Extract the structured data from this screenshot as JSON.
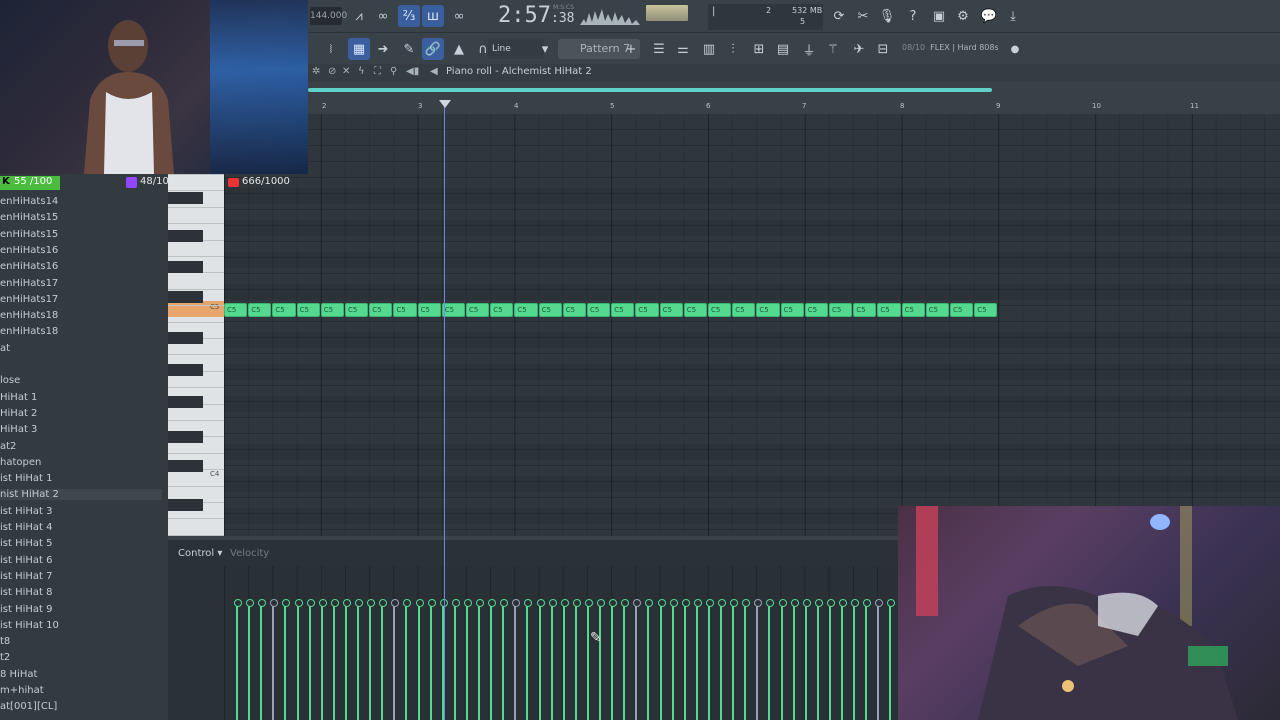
{
  "toolbar": {
    "tempo": "144.000",
    "time": {
      "minutes": "2:57",
      "seconds": "38",
      "unit_label": "M:S:CS"
    },
    "cpu": {
      "voices": "2",
      "memory": "532 MB",
      "polyphony": "5"
    },
    "draw_tool": "Line",
    "pattern": "Pattern 7",
    "hint": {
      "counter": "08/10",
      "text": "FLEX | Hard 808s"
    }
  },
  "piano_roll": {
    "title": "Piano roll - Alchemist HiHat 2",
    "bars": [
      "2",
      "3",
      "4",
      "5",
      "6",
      "7",
      "8",
      "9",
      "10",
      "11"
    ],
    "key_labels": {
      "c5": "C5",
      "c4": "C4"
    },
    "note_label": "C5"
  },
  "control": {
    "label": "Control",
    "target": "Velocity"
  },
  "counters": {
    "kick": {
      "icon": "K",
      "value": "55",
      "total": "/100"
    },
    "purple": "48/100",
    "youtube": "666/1000"
  },
  "browser": {
    "items": [
      "enHiHats14",
      "enHiHats15",
      "enHiHats15",
      "enHiHats16",
      "enHiHats16",
      "enHiHats17",
      "enHiHats17",
      "enHiHats18",
      "enHiHats18",
      "at",
      "",
      "lose",
      " HiHat 1",
      " HiHat 2",
      " HiHat 3",
      "at2",
      "hatopen",
      "ist HiHat 1",
      "nist HiHat 2",
      "ist HiHat 3",
      "ist HiHat 4",
      "ist HiHat 5",
      "ist HiHat 6",
      "ist HiHat 7",
      "ist HiHat 8",
      "ist HiHat 9",
      "ist HiHat 10",
      "t8",
      "t2",
      "8 HiHat",
      "m+hihat",
      "at[001][CL]"
    ],
    "selected_index": 18
  },
  "colors": {
    "note": "#54d98f",
    "playhead": "#6f86e8",
    "timeline_loop": "#5fd1c9",
    "selected_key": "#e7a56b"
  }
}
